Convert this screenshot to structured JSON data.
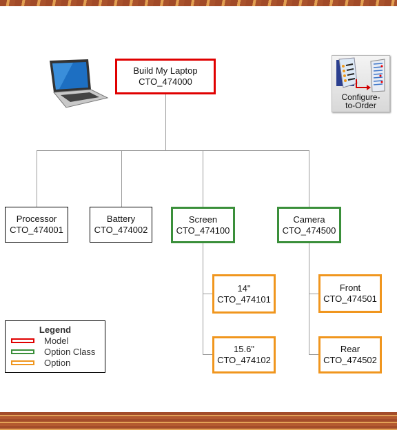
{
  "model": {
    "name": "Build My Laptop",
    "code": "CTO_474000"
  },
  "items": [
    {
      "name": "Processor",
      "code": "CTO_474001"
    },
    {
      "name": "Battery",
      "code": "CTO_474002"
    }
  ],
  "option_classes": [
    {
      "name": "Screen",
      "code": "CTO_474100",
      "options": [
        {
          "name": "14\"",
          "code": "CTO_474101"
        },
        {
          "name": "15.6\"",
          "code": "CTO_474102"
        }
      ]
    },
    {
      "name": "Camera",
      "code": "CTO_474500",
      "options": [
        {
          "name": "Front",
          "code": "CTO_474501"
        },
        {
          "name": "Rear",
          "code": "CTO_474502"
        }
      ]
    }
  ],
  "cto_icon": {
    "label_line1": "Configure-",
    "label_line2": "to-Order"
  },
  "legend": {
    "title": "Legend",
    "entries": [
      {
        "label": "Model",
        "color": "#e00000"
      },
      {
        "label": "Option Class",
        "color": "#3a8f3a"
      },
      {
        "label": "Option",
        "color": "#f0961e"
      }
    ]
  }
}
